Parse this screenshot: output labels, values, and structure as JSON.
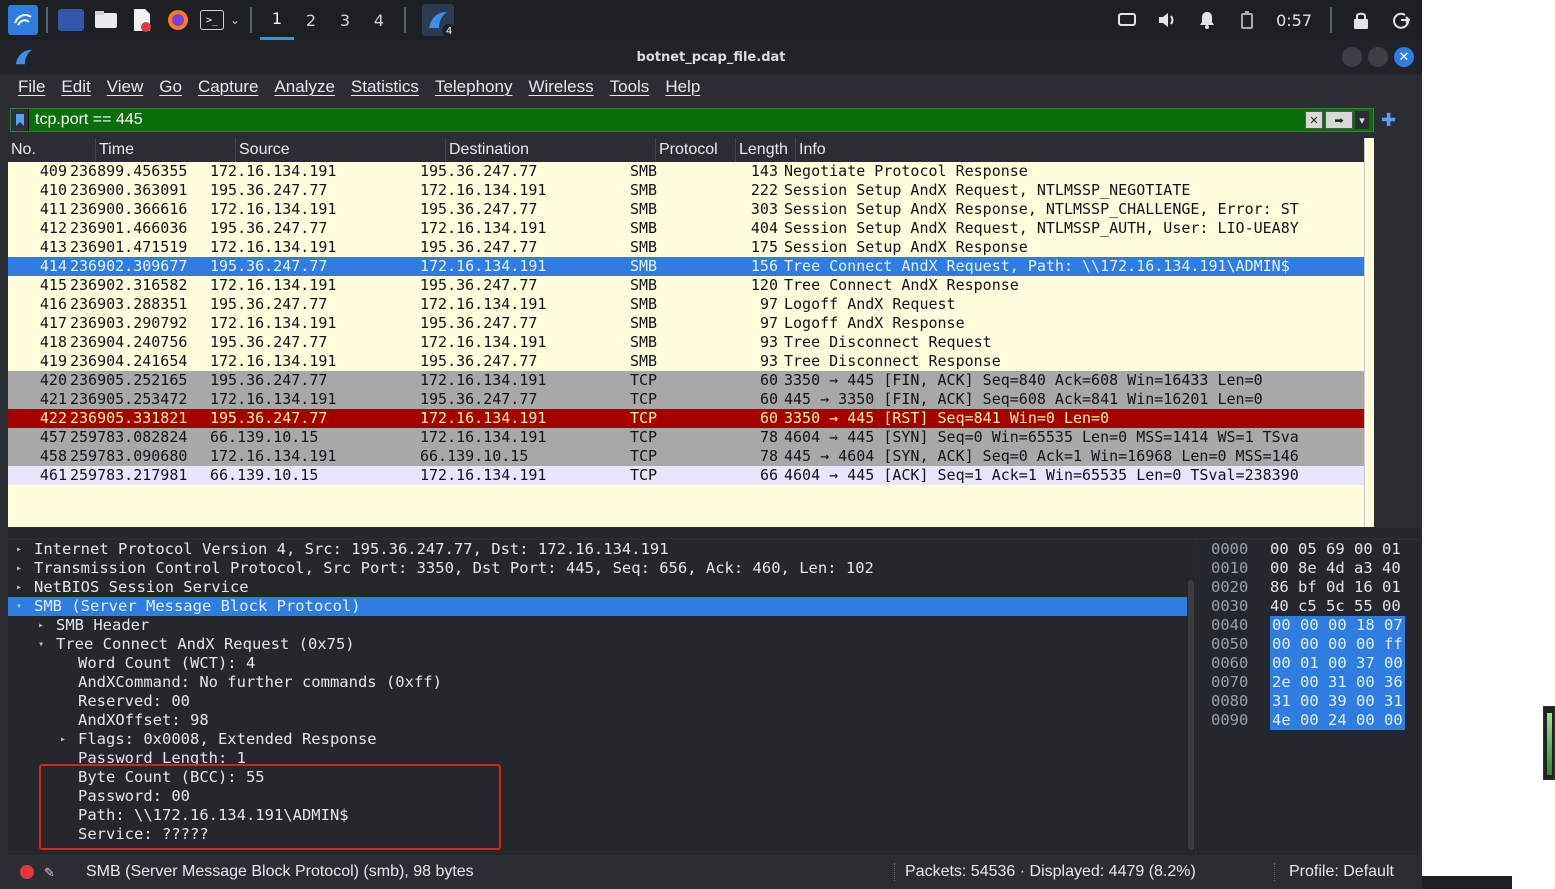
{
  "taskbar": {
    "workspaces": [
      "1",
      "2",
      "3",
      "4"
    ],
    "active_workspace": 0,
    "wireshark_badge": "4",
    "clock": "0:57"
  },
  "window": {
    "title": "botnet_pcap_file.dat"
  },
  "menu": [
    "File",
    "Edit",
    "View",
    "Go",
    "Capture",
    "Analyze",
    "Statistics",
    "Telephony",
    "Wireless",
    "Tools",
    "Help"
  ],
  "filter": {
    "value": "tcp.port == 445",
    "color": "#0a6e0a"
  },
  "packet_list": {
    "columns": [
      "No.",
      "Time",
      "Source",
      "Destination",
      "Protocol",
      "Length",
      "Info"
    ],
    "rows": [
      {
        "no": "409",
        "time": "236899.456355",
        "src": "172.16.134.191",
        "dst": "195.36.247.77",
        "proto": "SMB",
        "len": "143",
        "info": "Negotiate Protocol Response",
        "style": "smb"
      },
      {
        "no": "410",
        "time": "236900.363091",
        "src": "195.36.247.77",
        "dst": "172.16.134.191",
        "proto": "SMB",
        "len": "222",
        "info": "Session Setup AndX Request, NTLMSSP_NEGOTIATE",
        "style": "smb"
      },
      {
        "no": "411",
        "time": "236900.366616",
        "src": "172.16.134.191",
        "dst": "195.36.247.77",
        "proto": "SMB",
        "len": "303",
        "info": "Session Setup AndX Response, NTLMSSP_CHALLENGE, Error: ST",
        "style": "smb"
      },
      {
        "no": "412",
        "time": "236901.466036",
        "src": "195.36.247.77",
        "dst": "172.16.134.191",
        "proto": "SMB",
        "len": "404",
        "info": "Session Setup AndX Request, NTLMSSP_AUTH, User: LIO-UEA8Y",
        "style": "smb"
      },
      {
        "no": "413",
        "time": "236901.471519",
        "src": "172.16.134.191",
        "dst": "195.36.247.77",
        "proto": "SMB",
        "len": "175",
        "info": "Session Setup AndX Response",
        "style": "smb"
      },
      {
        "no": "414",
        "time": "236902.309677",
        "src": "195.36.247.77",
        "dst": "172.16.134.191",
        "proto": "SMB",
        "len": "156",
        "info": "Tree Connect AndX Request, Path: \\\\172.16.134.191\\ADMIN$",
        "style": "sel"
      },
      {
        "no": "415",
        "time": "236902.316582",
        "src": "172.16.134.191",
        "dst": "195.36.247.77",
        "proto": "SMB",
        "len": "120",
        "info": "Tree Connect AndX Response",
        "style": "smb"
      },
      {
        "no": "416",
        "time": "236903.288351",
        "src": "195.36.247.77",
        "dst": "172.16.134.191",
        "proto": "SMB",
        "len": "97",
        "info": "Logoff AndX Request",
        "style": "smb"
      },
      {
        "no": "417",
        "time": "236903.290792",
        "src": "172.16.134.191",
        "dst": "195.36.247.77",
        "proto": "SMB",
        "len": "97",
        "info": "Logoff AndX Response",
        "style": "smb"
      },
      {
        "no": "418",
        "time": "236904.240756",
        "src": "195.36.247.77",
        "dst": "172.16.134.191",
        "proto": "SMB",
        "len": "93",
        "info": "Tree Disconnect Request",
        "style": "smb"
      },
      {
        "no": "419",
        "time": "236904.241654",
        "src": "172.16.134.191",
        "dst": "195.36.247.77",
        "proto": "SMB",
        "len": "93",
        "info": "Tree Disconnect Response",
        "style": "smb"
      },
      {
        "no": "420",
        "time": "236905.252165",
        "src": "195.36.247.77",
        "dst": "172.16.134.191",
        "proto": "TCP",
        "len": "60",
        "info": "3350 → 445 [FIN, ACK] Seq=840 Ack=608 Win=16433 Len=0",
        "style": "tcp"
      },
      {
        "no": "421",
        "time": "236905.253472",
        "src": "172.16.134.191",
        "dst": "195.36.247.77",
        "proto": "TCP",
        "len": "60",
        "info": "445 → 3350 [FIN, ACK] Seq=608 Ack=841 Win=16201 Len=0",
        "style": "tcp"
      },
      {
        "no": "422",
        "time": "236905.331821",
        "src": "195.36.247.77",
        "dst": "172.16.134.191",
        "proto": "TCP",
        "len": "60",
        "info": "3350 → 445 [RST] Seq=841 Win=0 Len=0",
        "style": "rst"
      },
      {
        "no": "457",
        "time": "259783.082824",
        "src": "66.139.10.15",
        "dst": "172.16.134.191",
        "proto": "TCP",
        "len": "78",
        "info": "4604 → 445 [SYN] Seq=0 Win=65535 Len=0 MSS=1414 WS=1 TSva",
        "style": "syn"
      },
      {
        "no": "458",
        "time": "259783.090680",
        "src": "172.16.134.191",
        "dst": "66.139.10.15",
        "proto": "TCP",
        "len": "78",
        "info": "445 → 4604 [SYN, ACK] Seq=0 Ack=1 Win=16968 Len=0 MSS=146",
        "style": "syn"
      },
      {
        "no": "461",
        "time": "259783.217981",
        "src": "66.139.10.15",
        "dst": "172.16.134.191",
        "proto": "TCP",
        "len": "66",
        "info": "4604 → 445 [ACK] Seq=1 Ack=1 Win=65535 Len=0 TSval=238390",
        "style": "ack"
      }
    ]
  },
  "details": [
    {
      "text": "Internet Protocol Version 4, Src: 195.36.247.77, Dst: 172.16.134.191",
      "level": 0,
      "arrow": "collapsed"
    },
    {
      "text": "Transmission Control Protocol, Src Port: 3350, Dst Port: 445, Seq: 656, Ack: 460, Len: 102",
      "level": 0,
      "arrow": "collapsed"
    },
    {
      "text": "NetBIOS Session Service",
      "level": 0,
      "arrow": "collapsed"
    },
    {
      "text": "SMB (Server Message Block Protocol)",
      "level": 0,
      "arrow": "expanded",
      "selected": true
    },
    {
      "text": "SMB Header",
      "level": 1,
      "arrow": "collapsed"
    },
    {
      "text": "Tree Connect AndX Request (0x75)",
      "level": 1,
      "arrow": "expanded"
    },
    {
      "text": "Word Count (WCT): 4",
      "level": 2,
      "arrow": "none"
    },
    {
      "text": "AndXCommand: No further commands (0xff)",
      "level": 2,
      "arrow": "none"
    },
    {
      "text": "Reserved: 00",
      "level": 2,
      "arrow": "none"
    },
    {
      "text": "AndXOffset: 98",
      "level": 2,
      "arrow": "none"
    },
    {
      "text": "Flags: 0x0008, Extended Response",
      "level": 2,
      "arrow": "collapsed"
    },
    {
      "text": "Password Length: 1",
      "level": 2,
      "arrow": "none"
    },
    {
      "text": "Byte Count (BCC): 55",
      "level": 2,
      "arrow": "none"
    },
    {
      "text": "Password: 00",
      "level": 2,
      "arrow": "none"
    },
    {
      "text": "Path: \\\\172.16.134.191\\ADMIN$",
      "level": 2,
      "arrow": "none"
    },
    {
      "text": "Service: ?????",
      "level": 2,
      "arrow": "none"
    }
  ],
  "hex": [
    {
      "offset": "0000",
      "bytes": "00 05 69 00 01",
      "hl": false
    },
    {
      "offset": "0010",
      "bytes": "00 8e 4d a3 40",
      "hl": false
    },
    {
      "offset": "0020",
      "bytes": "86 bf 0d 16 01",
      "hl": false
    },
    {
      "offset": "0030",
      "bytes": "40 c5 5c 55 00",
      "hl": false
    },
    {
      "offset": "0040",
      "bytes": "00 00 00 18 07",
      "hl": true
    },
    {
      "offset": "0050",
      "bytes": "00 00 00 00 ff",
      "hl": true
    },
    {
      "offset": "0060",
      "bytes": "00 01 00 37 00",
      "hl": true
    },
    {
      "offset": "0070",
      "bytes": "2e 00 31 00 36",
      "hl": true
    },
    {
      "offset": "0080",
      "bytes": "31 00 39 00 31",
      "hl": true
    },
    {
      "offset": "0090",
      "bytes": "4e 00 24 00 00",
      "hl": true
    }
  ],
  "status": {
    "main": "SMB (Server Message Block Protocol) (smb), 98 bytes",
    "packets": "Packets: 54536 · Displayed: 4479 (8.2%)",
    "profile": "Profile: Default"
  }
}
